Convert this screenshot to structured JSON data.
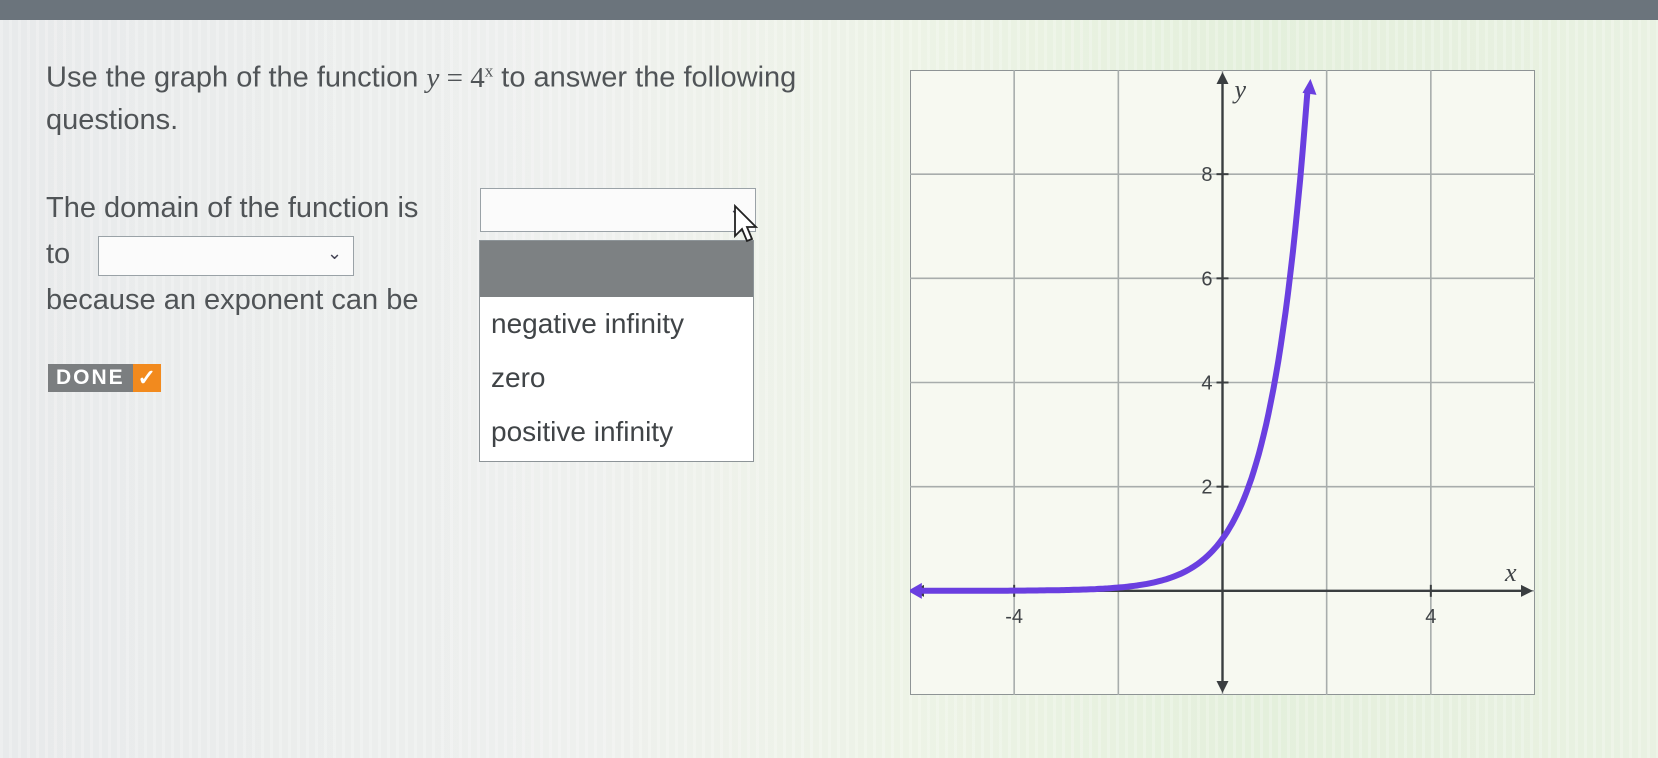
{
  "question": {
    "prefix": "Use the graph of the function",
    "function_lhs": "y",
    "function_eq": " = 4",
    "function_exp": "x",
    "suffix": "to answer the following questions."
  },
  "domain_sentence": {
    "part1": "The domain of the function is",
    "part2": "to",
    "part3": "because an exponent can be"
  },
  "select_1": {
    "value": ""
  },
  "select_2": {
    "value": ""
  },
  "dropdown": {
    "options": [
      "negative infinity",
      "zero",
      "positive infinity"
    ]
  },
  "done_button": {
    "label": "DONE",
    "icon": "check-icon",
    "check_color": "#f28a1e"
  },
  "chart_data": {
    "type": "line",
    "function": "y = 4^x",
    "x": [
      -5,
      -4,
      -3,
      -2,
      -1,
      -0.5,
      0,
      0.5,
      1,
      1.25,
      1.5,
      1.75
    ],
    "y": [
      0.001,
      0.004,
      0.016,
      0.0625,
      0.25,
      0.5,
      1,
      2,
      4,
      5.66,
      8,
      11.31
    ],
    "xlabel": "x",
    "ylabel": "y",
    "xlim": [
      -6,
      6
    ],
    "ylim": [
      -2,
      10
    ],
    "x_tick_labels": [
      "-4",
      "4"
    ],
    "y_tick_labels": [
      "2",
      "4",
      "6",
      "8"
    ],
    "grid": true,
    "line_color": "#6a3fe0"
  }
}
